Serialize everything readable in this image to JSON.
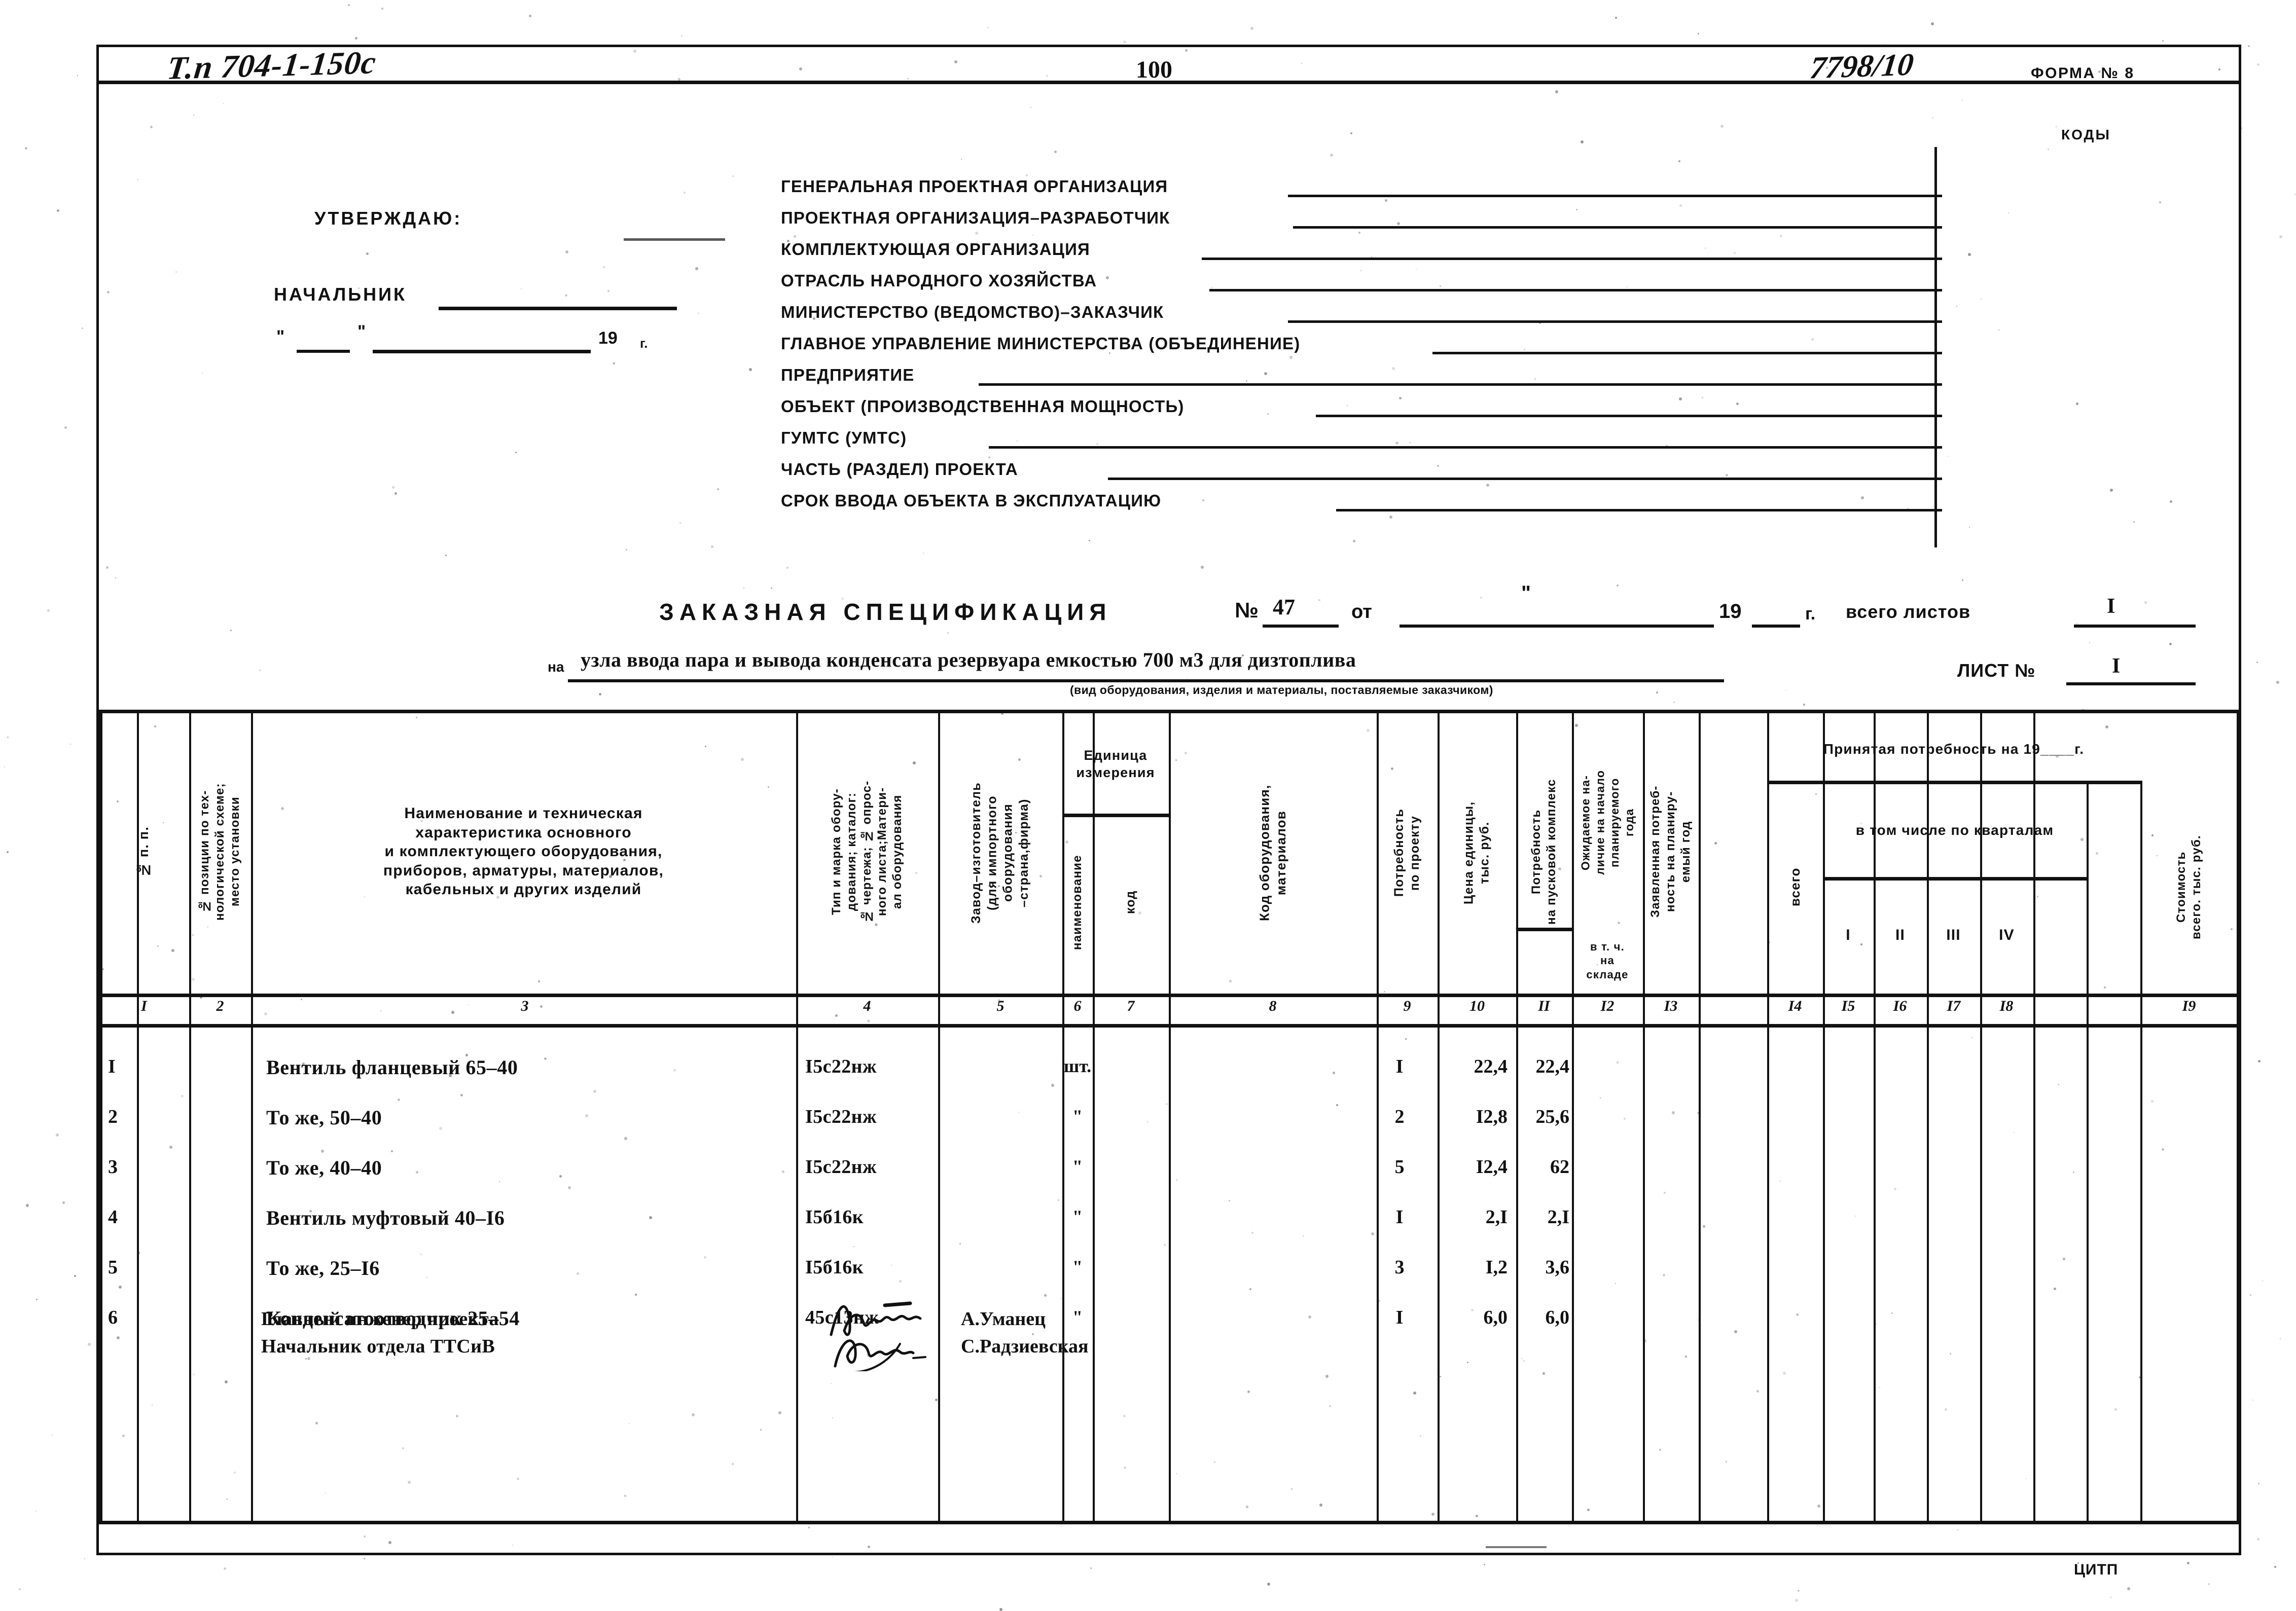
{
  "header": {
    "doc_code": "Т.п 704-1-150с",
    "page_number": "100",
    "order_code": "7798/10",
    "form_label": "ФОРМА № 8",
    "codes_label": "КОДЫ"
  },
  "approval": {
    "approve_label": "УТВЕРЖДАЮ:",
    "chief_label": "НАЧАЛЬНИК",
    "quote_open": "\"",
    "quote_close": "\"",
    "year_prefix": "19",
    "year_suffix": "г."
  },
  "org_fields": [
    {
      "label": "ГЕНЕРАЛЬНАЯ ПРОЕКТНАЯ ОРГАНИЗАЦИЯ",
      "value": ""
    },
    {
      "label": "ПРОЕКТНАЯ ОРГАНИЗАЦИЯ–РАЗРАБОТЧИК",
      "value": ""
    },
    {
      "label": "КОМПЛЕКТУЮЩАЯ ОРГАНИЗАЦИЯ",
      "value": ""
    },
    {
      "label": "ОТРАСЛЬ НАРОДНОГО ХОЗЯЙСТВА",
      "value": ""
    },
    {
      "label": "МИНИСТЕРСТВО (ВЕДОМСТВО)–ЗАКАЗЧИК",
      "value": ""
    },
    {
      "label": "ГЛАВНОЕ УПРАВЛЕНИЕ МИНИСТЕРСТВА (ОБЪЕДИНЕНИЕ)",
      "value": ""
    },
    {
      "label": "ПРЕДПРИЯТИЕ",
      "value": ""
    },
    {
      "label": "ОБЪЕКТ (ПРОИЗВОДСТВЕННАЯ МОЩНОСТЬ)",
      "value": ""
    },
    {
      "label": "ГУМТС (УМТС)",
      "value": ""
    },
    {
      "label": "ЧАСТЬ (РАЗДЕЛ) ПРОЕКТА",
      "value": ""
    },
    {
      "label": "СРОК ВВОДА ОБЪЕКТА В ЭКСПЛУАТАЦИЮ",
      "value": ""
    }
  ],
  "spec": {
    "title": "ЗАКАЗНАЯ СПЕЦИФИКАЦИЯ",
    "no_label": "№",
    "no_value": "47",
    "from_label": "от",
    "year_prefix": "19",
    "year_suffix": "г.",
    "sheets_label": "всего листов",
    "sheets_value": "I",
    "na_label": "на",
    "subject": "узла ввода пара и вывода конденсата резервуара емкостью 700 м3 для дизтоплива",
    "caption": "(вид оборудования, изделия и материалы, поставляемые заказчиком)",
    "list_label": "ЛИСТ №",
    "list_value": "I"
  },
  "table": {
    "headers": {
      "c1": "№ п. п.",
      "c2": "№ позиции по тех-\nнологической схеме;\nместо установки",
      "c3": "Наименование  и  техническая\nхарактеристика основного\nи комплектующего оборудования,\nприборов, арматуры, материалов,\nкабельных и других изделий",
      "c4": "Тип и марка обору-\nдования; каталог:\n№ чертежа; № опрос-\nного листа;Матери-\nал оборудования",
      "c5": "Завод–изготовитель\n(для импортного\nоборудования\n–страна,фирма)",
      "unit_group": "Единица\nизмерения",
      "c6": "наименование",
      "c7": "код",
      "c8": "Код оборудования,\nматериалов",
      "c9": "Потребность\nпо проекту",
      "c10": "Цена единицы,\nтыс. руб.",
      "c11": "Потребность\nна пусковой комплекс",
      "c12": "Ожидаемое на-\nличие на начало\nпланируемого\nгода",
      "c12b": "в т. ч.\nна\nскладе",
      "c13": "Заявленная потреб-\nность на планиру-\nемый год",
      "accepted_group": "Принятая потребность на 19____г.",
      "c14": "всего",
      "quarters_group": "в том числе по кварталам",
      "c15": "I",
      "c16": "II",
      "c17": "III",
      "c18": "IV",
      "c19": "Стоимость\nвсего. тыс. руб."
    },
    "column_numbers": [
      "I",
      "2",
      "3",
      "4",
      "5",
      "6",
      "7",
      "8",
      "9",
      "10",
      "II",
      "I2",
      "I3",
      "I4",
      "I5",
      "I6",
      "I7",
      "I8",
      "I9"
    ],
    "rows": [
      {
        "no": "I",
        "pos": "",
        "name": "Вентиль фланцевый 65–40",
        "mark": "I5с22нж",
        "maker": "",
        "unit": "шт.",
        "unit_code": "",
        "code": "",
        "qty": "I",
        "price": "22,4",
        "startup": "22,4",
        "expected": "",
        "declared": "",
        "total": "",
        "q1": "",
        "q2": "",
        "q3": "",
        "q4": "",
        "cost": ""
      },
      {
        "no": "2",
        "pos": "",
        "name": "То же, 50–40",
        "mark": "I5с22нж",
        "maker": "",
        "unit": "\"",
        "unit_code": "",
        "code": "",
        "qty": "2",
        "price": "I2,8",
        "startup": "25,6",
        "expected": "",
        "declared": "",
        "total": "",
        "q1": "",
        "q2": "",
        "q3": "",
        "q4": "",
        "cost": ""
      },
      {
        "no": "3",
        "pos": "",
        "name": "То же, 40–40",
        "mark": "I5с22нж",
        "maker": "",
        "unit": "\"",
        "unit_code": "",
        "code": "",
        "qty": "5",
        "price": "I2,4",
        "startup": "62",
        "expected": "",
        "declared": "",
        "total": "",
        "q1": "",
        "q2": "",
        "q3": "",
        "q4": "",
        "cost": ""
      },
      {
        "no": "4",
        "pos": "",
        "name": "Вентиль муфтовый 40–I6",
        "mark": "I5б16к",
        "maker": "",
        "unit": "\"",
        "unit_code": "",
        "code": "",
        "qty": "I",
        "price": "2,I",
        "startup": "2,I",
        "expected": "",
        "declared": "",
        "total": "",
        "q1": "",
        "q2": "",
        "q3": "",
        "q4": "",
        "cost": ""
      },
      {
        "no": "5",
        "pos": "",
        "name": "То же, 25–I6",
        "mark": "I5б16к",
        "maker": "",
        "unit": "\"",
        "unit_code": "",
        "code": "",
        "qty": "3",
        "price": "I,2",
        "startup": "3,6",
        "expected": "",
        "declared": "",
        "total": "",
        "q1": "",
        "q2": "",
        "q3": "",
        "q4": "",
        "cost": ""
      },
      {
        "no": "6",
        "pos": "",
        "name": "Конденсатоотводчик 25–54",
        "mark": "45с13нж",
        "maker": "",
        "unit": "\"",
        "unit_code": "",
        "code": "",
        "qty": "I",
        "price": "6,0",
        "startup": "6,0",
        "expected": "",
        "declared": "",
        "total": "",
        "q1": "",
        "q2": "",
        "q3": "",
        "q4": "",
        "cost": ""
      }
    ]
  },
  "signatures": [
    {
      "role": "Главный инженер проекта",
      "name": "А.Уманец"
    },
    {
      "role": "Начальник отдела ТТСиВ",
      "name": "С.Радзиевская"
    }
  ],
  "footer": {
    "publisher": "ЦИТП"
  }
}
